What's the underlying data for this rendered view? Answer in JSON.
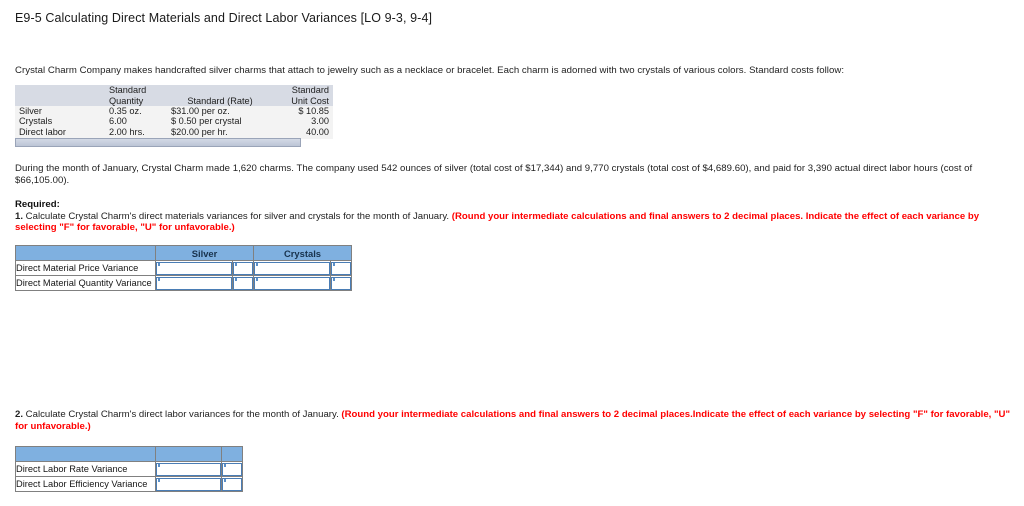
{
  "exercise": {
    "title": "E9-5 Calculating Direct Materials and Direct Labor Variances [LO 9-3, 9-4]",
    "intro": "Crystal Charm Company makes handcrafted silver charms that attach to jewelry such as a necklace or bracelet. Each charm is adorned with two crystals of various colors. Standard costs follow:",
    "during": "During the month of January, Crystal Charm made 1,620 charms. The company used 542 ounces of silver (total cost of $17,344) and 9,770 crystals (total cost of $4,689.60), and paid for 3,390 actual direct labor hours (cost of $66,105.00)."
  },
  "standard_costs_table": {
    "headers": {
      "blank": "",
      "quantity_line1": "Standard",
      "quantity_line2": "Quantity",
      "rate": "Standard (Rate)",
      "unit_cost_line1": "Standard",
      "unit_cost_line2": "Unit Cost"
    },
    "rows": [
      {
        "label": "Silver",
        "quantity": "0.35 oz.",
        "rate": "$31.00 per oz.",
        "unit_cost": "$  10.85"
      },
      {
        "label": "Crystals",
        "quantity": "6.00",
        "rate": "$  0.50 per crystal",
        "unit_cost": "3.00"
      },
      {
        "label": "Direct labor",
        "quantity": "2.00 hrs.",
        "rate": "$20.00 per hr.",
        "unit_cost": "40.00"
      }
    ]
  },
  "required": {
    "label": "Required:",
    "item1": {
      "number": "1.",
      "text": " Calculate Crystal Charm's direct materials variances for silver and crystals for the month of January. ",
      "note": "(Round your intermediate calculations and final answers to 2 decimal places. Indicate the effect of each variance by selecting \"F\" for favorable, \"U\" for unfavorable.)"
    },
    "item2": {
      "number": "2.",
      "text": " Calculate Crystal Charm's direct labor variances for the month of January. ",
      "note": "(Round your intermediate calculations and final answers to 2 decimal places.Indicate the effect of each variance by selecting \"F\" for favorable, \"U\" for unfavorable.)"
    }
  },
  "materials_variance_table": {
    "headers": {
      "blank": "",
      "silver": "Silver",
      "crystals": "Crystals"
    },
    "rows": [
      {
        "label": "Direct Material Price Variance",
        "silver_amount": "",
        "silver_effect": "",
        "crystals_amount": "",
        "crystals_effect": ""
      },
      {
        "label": "Direct Material Quantity Variance",
        "silver_amount": "",
        "silver_effect": "",
        "crystals_amount": "",
        "crystals_effect": ""
      }
    ]
  },
  "labor_variance_table": {
    "headers": {
      "blank": "",
      "amount": "",
      "effect": ""
    },
    "rows": [
      {
        "label": "Direct Labor Rate Variance",
        "amount": "",
        "effect": ""
      },
      {
        "label": "Direct Labor Efficiency Variance",
        "amount": "",
        "effect": ""
      }
    ]
  },
  "colors": {
    "header_blue": "#7fb0e0",
    "std_header_grey": "#d7dbe4",
    "note_red": "#ff0000",
    "input_border": "#4a7db5"
  }
}
